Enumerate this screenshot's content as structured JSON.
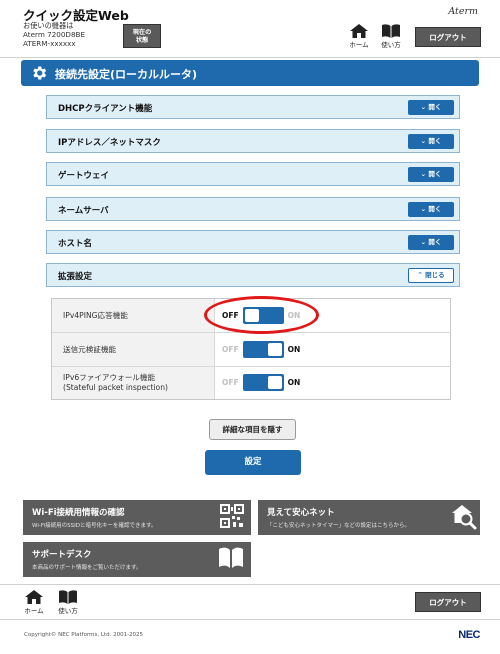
{
  "header": {
    "app_title": "クイック設定Web",
    "device_line1": "お使いの機器は",
    "device_line2": "Aterm 7200D8BE",
    "device_line3": "ATERM-xxxxxx",
    "status_line1": "現在の",
    "status_line2": "状態",
    "brand_logo": "Aterm",
    "home_label": "ホーム",
    "guide_label": "使い方",
    "logout_label": "ログアウト"
  },
  "section": {
    "title": "接続先設定(ローカルルータ)",
    "icon": "gear-icon"
  },
  "accordions": [
    {
      "label": "DHCPクライアント機能",
      "button": "開く",
      "expanded": false
    },
    {
      "label": "IPアドレス／ネットマスク",
      "button": "開く",
      "expanded": false
    },
    {
      "label": "ゲートウェイ",
      "button": "開く",
      "expanded": false
    },
    {
      "label": "ネームサーバ",
      "button": "開く",
      "expanded": false
    },
    {
      "label": "ホスト名",
      "button": "開く",
      "expanded": false
    },
    {
      "label": "拡張設定",
      "button": "閉じる",
      "expanded": true
    }
  ],
  "settings": [
    {
      "label_line1": "IPv4PING応答機能",
      "label_line2": "",
      "off_label": "OFF",
      "on_label": "ON",
      "state": "OFF"
    },
    {
      "label_line1": "送信元検証機能",
      "label_line2": "",
      "off_label": "OFF",
      "on_label": "ON",
      "state": "ON"
    },
    {
      "label_line1": "IPv6ファイアウォール機能",
      "label_line2": "(Stateful packet inspection)",
      "off_label": "OFF",
      "on_label": "ON",
      "state": "ON"
    }
  ],
  "actions": {
    "hide_details_label": "詳細な項目を隠す",
    "submit_label": "設定"
  },
  "tiles": {
    "wifi": {
      "title": "Wi-Fi接続用情報の確認",
      "desc": "Wi-Fi接続用のSSIDと暗号化キーを確認できます。",
      "icon": "qr-code-icon"
    },
    "safety": {
      "title": "見えて安心ネット",
      "desc": "「こども安心ネットタイマー」などの設定はこちらから。",
      "icon": "home-search-icon"
    },
    "support": {
      "title": "サポートデスク",
      "desc": "本商品のサポート情報をご覧いただけます。",
      "icon": "book-icon"
    }
  },
  "footer": {
    "home_label": "ホーム",
    "guide_label": "使い方",
    "logout_label": "ログアウト",
    "copyright": "Copyright© NEC Platforms, Ltd. 2001-2025",
    "brand": "NEC"
  },
  "colors": {
    "accent": "#1e6aad",
    "highlight": "#e01818",
    "tile": "#5c5c5c"
  }
}
